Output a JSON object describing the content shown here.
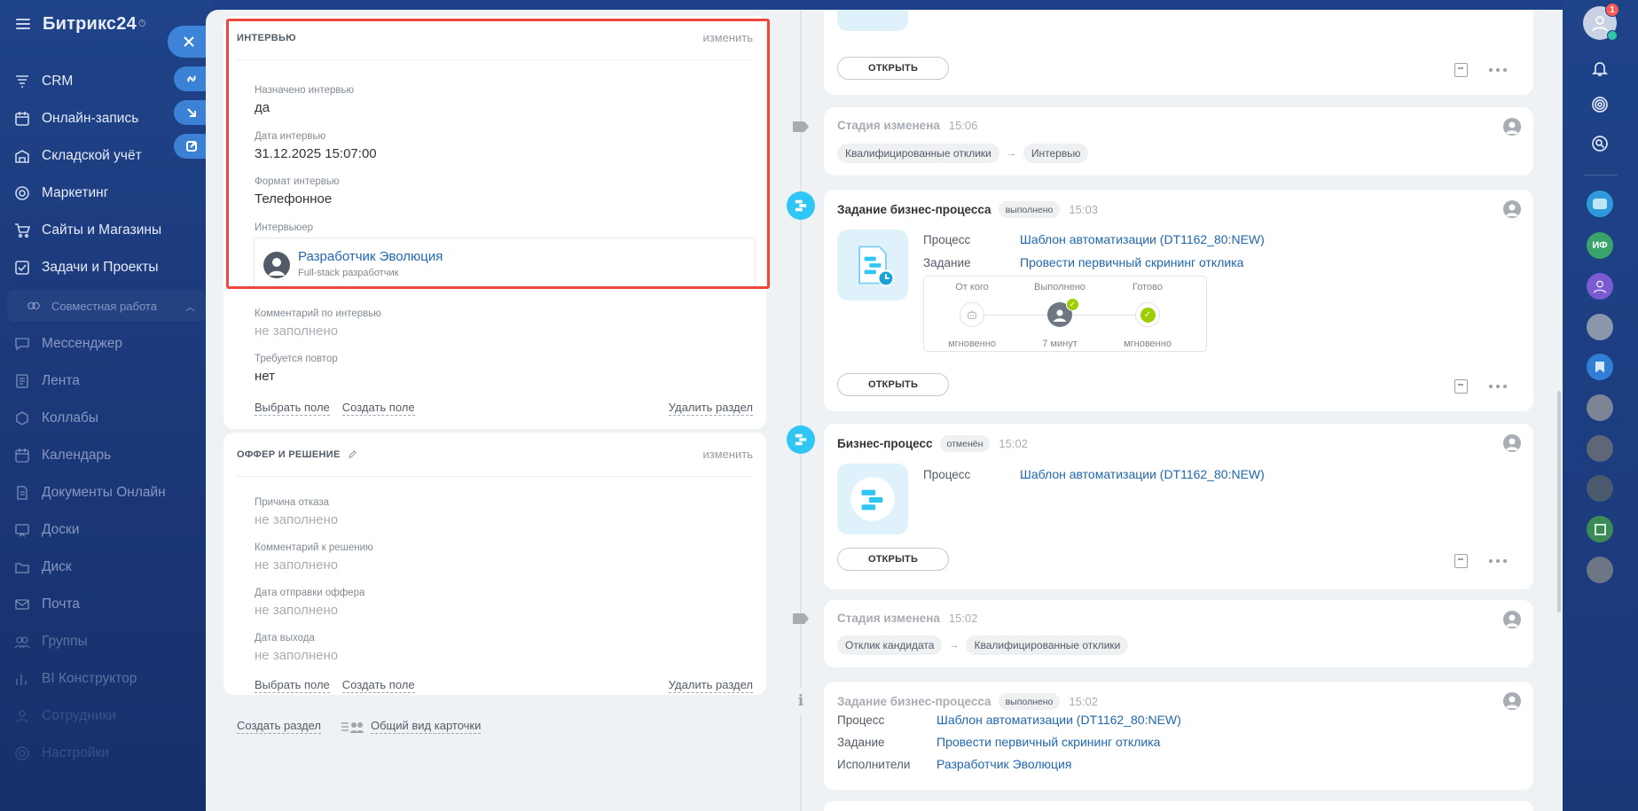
{
  "app": {
    "logo": "Битрикс24",
    "logo_suffix": "⏱"
  },
  "sidebar": {
    "items": [
      {
        "label": "CRM",
        "icon": "funnel-icon"
      },
      {
        "label": "Онлайн-запись",
        "icon": "calendar-booking-icon"
      },
      {
        "label": "Складской учёт",
        "icon": "warehouse-icon"
      },
      {
        "label": "Маркетинг",
        "icon": "target-icon"
      },
      {
        "label": "Сайты и Магазины",
        "icon": "cart-icon"
      },
      {
        "label": "Задачи и Проекты",
        "icon": "checkbox-icon"
      }
    ],
    "group_label": "Совместная работа",
    "group_items": [
      {
        "label": "Мессенджер",
        "icon": "chat-icon"
      },
      {
        "label": "Лента",
        "icon": "feed-icon"
      },
      {
        "label": "Коллабы",
        "icon": "collab-icon"
      },
      {
        "label": "Календарь",
        "icon": "calendar-icon"
      },
      {
        "label": "Документы Онлайн",
        "icon": "document-icon"
      },
      {
        "label": "Доски",
        "icon": "board-icon"
      },
      {
        "label": "Диск",
        "icon": "disk-icon"
      },
      {
        "label": "Почта",
        "icon": "mail-icon"
      },
      {
        "label": "Группы",
        "icon": "groups-icon"
      },
      {
        "label": "BI Конструктор",
        "icon": "bi-icon"
      },
      {
        "label": "Сотрудники",
        "icon": "employees-icon"
      },
      {
        "label": "Настройки",
        "icon": "settings-icon"
      }
    ]
  },
  "right_rail": {
    "notifications_count": "1",
    "contact_initials": "ИФ"
  },
  "sections": {
    "interview": {
      "title": "ИНТЕРВЬЮ",
      "edit": "изменить",
      "fields": [
        {
          "label": "Назначено интервью",
          "value": "да"
        },
        {
          "label": "Дата интервью",
          "value": "31.12.2025 15:07:00"
        },
        {
          "label": "Формат интервью",
          "value": "Телефонное"
        },
        {
          "label": "Интервьюер",
          "value": ""
        },
        {
          "label": "Комментарий по интервью",
          "value": "не заполнено"
        },
        {
          "label": "Требуется повтор",
          "value": "нет"
        }
      ],
      "interviewer": {
        "name": "Разработчик Эволюция",
        "position": "Full-stack разработчик"
      },
      "links": {
        "select": "Выбрать поле",
        "create": "Создать поле",
        "delete": "Удалить раздел"
      }
    },
    "offer": {
      "title": "ОФФЕР И РЕШЕНИЕ",
      "edit": "изменить",
      "fields": [
        {
          "label": "Причина отказа",
          "value": "не заполнено"
        },
        {
          "label": "Комментарий к решению",
          "value": "не заполнено"
        },
        {
          "label": "Дата отправки оффера",
          "value": "не заполнено"
        },
        {
          "label": "Дата выхода",
          "value": "не заполнено"
        }
      ],
      "links": {
        "select": "Выбрать поле",
        "create": "Создать поле",
        "delete": "Удалить раздел"
      }
    },
    "footer": {
      "create_section": "Создать раздел",
      "card_view": "Общий вид карточки"
    }
  },
  "timeline": {
    "open_label": "ОТКРЫТЬ",
    "stage1": {
      "title": "Стадия изменена",
      "time": "15:06",
      "from": "Квалифицированные отклики",
      "to": "Интервью"
    },
    "task1": {
      "title": "Задание бизнес-процесса",
      "status": "выполнено",
      "time": "15:03",
      "process_label": "Процесс",
      "process": "Шаблон автоматизации (DT1162_80:NEW)",
      "task_label": "Задание",
      "task": "Провести первичный скрининг отклика",
      "steps": [
        {
          "label": "От кого",
          "value": "мгновенно"
        },
        {
          "label": "Выполнено",
          "value": "7 минут"
        },
        {
          "label": "Готово",
          "value": "мгновенно"
        }
      ]
    },
    "bp": {
      "title": "Бизнес-процесс",
      "status": "отменён",
      "time": "15:02",
      "process_label": "Процесс",
      "process": "Шаблон автоматизации (DT1162_80:NEW)"
    },
    "stage2": {
      "title": "Стадия изменена",
      "time": "15:02",
      "from": "Отклик кандидата",
      "to": "Квалифицированные отклики"
    },
    "task2": {
      "title": "Задание бизнес-процесса",
      "status": "выполнено",
      "time": "15:02",
      "process_label": "Процесс",
      "process": "Шаблон автоматизации (DT1162_80:NEW)",
      "task_label": "Задание",
      "task": "Провести первичный скрининг отклика",
      "exec_label": "Исполнители",
      "exec": "Разработчик Эволюция"
    }
  }
}
